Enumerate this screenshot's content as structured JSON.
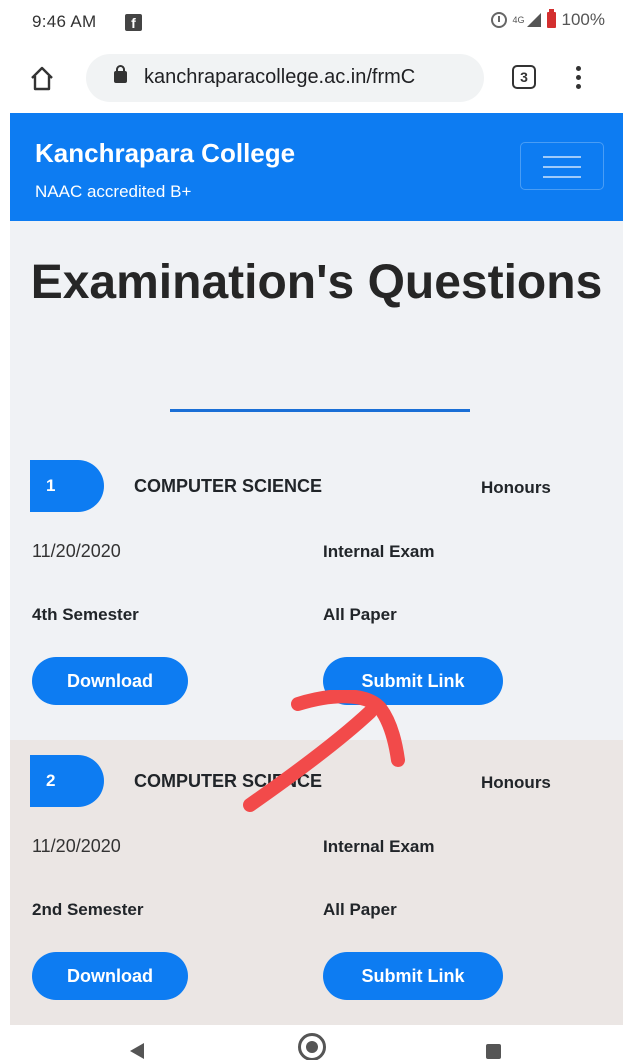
{
  "status_bar": {
    "time": "9:46 AM",
    "network": "4G",
    "battery": "100%"
  },
  "browser": {
    "url": "kanchraparacollege.ac.in/frmC",
    "tab_count": "3"
  },
  "site": {
    "brand": "Kanchrapara College",
    "tagline": "NAAC accredited B+"
  },
  "page": {
    "title": "Examination's Questions"
  },
  "records": [
    {
      "number": "1",
      "subject": "COMPUTER SCIENCE",
      "level": "Honours",
      "date": "11/20/2020",
      "exam_type": "Internal Exam",
      "semester": "4th Semester",
      "paper": "All Paper",
      "download_label": "Download",
      "submit_label": "Submit Link"
    },
    {
      "number": "2",
      "subject": "COMPUTER SCIENCE",
      "level": "Honours",
      "date": "11/20/2020",
      "exam_type": "Internal Exam",
      "semester": "2nd Semester",
      "paper": "All Paper",
      "download_label": "Download",
      "submit_label": "Submit Link"
    }
  ],
  "colors": {
    "primary": "#0d7cf2",
    "annotation": "#f24a4a",
    "content_bg": "#f0f2f5",
    "alt_row_bg": "#ebe6e4"
  },
  "icons": {
    "status": [
      "facebook-icon",
      "alarm-icon",
      "signal-icon",
      "battery-icon"
    ],
    "browser": [
      "home-icon",
      "lock-icon",
      "tabs-icon",
      "menu-dots-icon"
    ],
    "android": [
      "back-icon",
      "home-circle-icon",
      "recents-icon"
    ]
  }
}
